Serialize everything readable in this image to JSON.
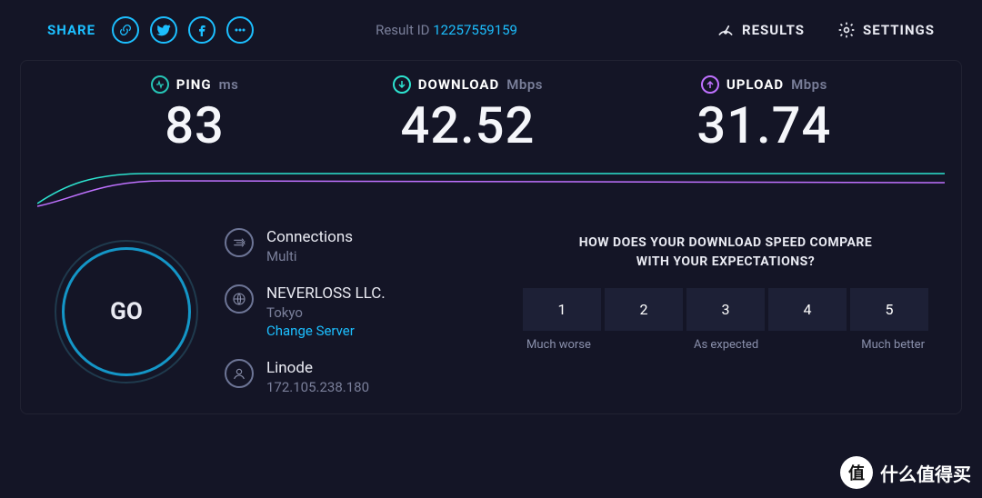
{
  "topbar": {
    "share_label": "SHARE",
    "result_id_label": "Result ID",
    "result_id_value": "12257559159",
    "results_label": "RESULTS",
    "settings_label": "SETTINGS"
  },
  "metrics": {
    "ping": {
      "label": "PING",
      "unit": "ms",
      "value": "83"
    },
    "download": {
      "label": "DOWNLOAD",
      "unit": "Mbps",
      "value": "42.52"
    },
    "upload": {
      "label": "UPLOAD",
      "unit": "Mbps",
      "value": "31.74"
    }
  },
  "go_label": "GO",
  "connection": {
    "connections_label": "Connections",
    "connections_value": "Multi",
    "server_name": "NEVERLOSS LLC.",
    "server_location": "Tokyo",
    "change_server_label": "Change Server",
    "isp_name": "Linode",
    "ip_address": "172.105.238.180"
  },
  "survey": {
    "question_line1": "HOW DOES YOUR DOWNLOAD SPEED COMPARE",
    "question_line2": "WITH YOUR EXPECTATIONS?",
    "options": [
      "1",
      "2",
      "3",
      "4",
      "5"
    ],
    "label_low": "Much worse",
    "label_mid": "As expected",
    "label_high": "Much better"
  },
  "watermark_text": "什么值得买",
  "watermark_badge": "值",
  "chart_data": {
    "type": "line",
    "note": "Speed-over-time traces drawn during the test; no numeric axes shown.",
    "series": [
      {
        "name": "download_trace",
        "color": "#2de3cf"
      },
      {
        "name": "upload_trace",
        "color": "#bf71ff"
      }
    ]
  }
}
